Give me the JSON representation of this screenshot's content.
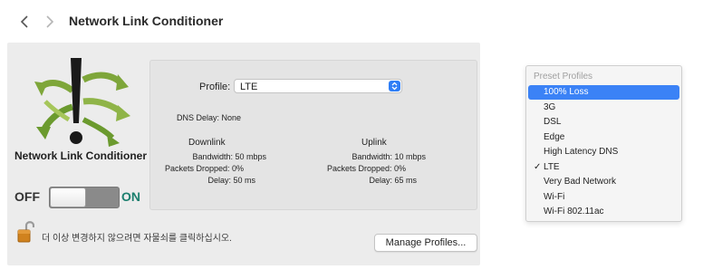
{
  "toolbar": {
    "title": "Network Link Conditioner"
  },
  "panel": {
    "app_name": "Network Link Conditioner",
    "switch": {
      "off_label": "OFF",
      "on_label": "ON",
      "state": "off"
    },
    "lock_text": "더 이상 변경하지 않으려면 자물쇠를 클릭하십시오.",
    "manage_button": "Manage Profiles..."
  },
  "profile": {
    "label": "Profile:",
    "selected": "LTE",
    "dns_delay": "DNS Delay: None",
    "downlink": {
      "header": "Downlink",
      "bandwidth": "Bandwidth: 50 mbps",
      "packets_dropped": "Packets Dropped: 0%",
      "delay": "Delay: 50 ms"
    },
    "uplink": {
      "header": "Uplink",
      "bandwidth": "Bandwidth: 10 mbps",
      "packets_dropped": "Packets Dropped: 0%",
      "delay": "Delay: 65 ms"
    }
  },
  "preset_menu": {
    "header": "Preset Profiles",
    "items": [
      {
        "label": "100% Loss",
        "highlighted": true,
        "checked": false
      },
      {
        "label": "3G",
        "highlighted": false,
        "checked": false
      },
      {
        "label": "DSL",
        "highlighted": false,
        "checked": false
      },
      {
        "label": "Edge",
        "highlighted": false,
        "checked": false
      },
      {
        "label": "High Latency DNS",
        "highlighted": false,
        "checked": false
      },
      {
        "label": "LTE",
        "highlighted": false,
        "checked": true
      },
      {
        "label": "Very Bad Network",
        "highlighted": false,
        "checked": false
      },
      {
        "label": "Wi-Fi",
        "highlighted": false,
        "checked": false
      },
      {
        "label": "Wi-Fi 802.11ac",
        "highlighted": false,
        "checked": false
      }
    ],
    "check_glyph": "✓"
  },
  "colors": {
    "accent": "#3b82f6",
    "on_label": "#1b7f6e",
    "pane_bg": "#ececec"
  }
}
